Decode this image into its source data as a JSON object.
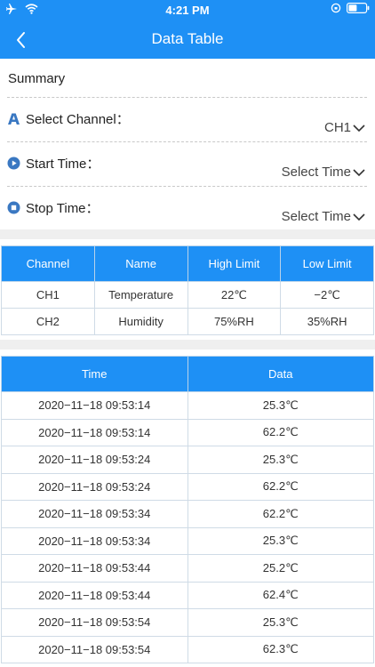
{
  "status_bar": {
    "time": "4:21 PM"
  },
  "nav": {
    "title": "Data Table"
  },
  "summary": {
    "title": "Summary",
    "rows": [
      {
        "label": "Select Channel：",
        "value": "CH1"
      },
      {
        "label": "Start Time：",
        "value": "Select Time"
      },
      {
        "label": "Stop Time：",
        "value": "Select Time"
      }
    ]
  },
  "limits_table": {
    "headers": [
      "Channel",
      "Name",
      "High Limit",
      "Low Limit"
    ],
    "rows": [
      [
        "CH1",
        "Temperature",
        "22℃",
        "−2℃"
      ],
      [
        "CH2",
        "Humidity",
        "75%RH",
        "35%RH"
      ]
    ]
  },
  "data_table": {
    "headers": [
      "Time",
      "Data"
    ],
    "rows": [
      [
        "2020−11−18 09:53:14",
        "25.3℃"
      ],
      [
        "2020−11−18 09:53:14",
        "62.2℃"
      ],
      [
        "2020−11−18 09:53:24",
        "25.3℃"
      ],
      [
        "2020−11−18 09:53:24",
        "62.2℃"
      ],
      [
        "2020−11−18 09:53:34",
        "62.2℃"
      ],
      [
        "2020−11−18 09:53:34",
        "25.3℃"
      ],
      [
        "2020−11−18 09:53:44",
        "25.2℃"
      ],
      [
        "2020−11−18 09:53:44",
        "62.4℃"
      ],
      [
        "2020−11−18 09:53:54",
        "25.3℃"
      ],
      [
        "2020−11−18 09:53:54",
        "62.3℃"
      ]
    ]
  },
  "colors": {
    "accent": "#1e90f5",
    "separator": "#efefef"
  }
}
